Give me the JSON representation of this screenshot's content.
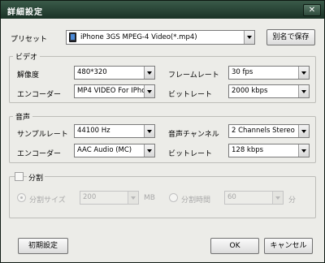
{
  "window": {
    "title": "詳細設定",
    "close_glyph": "✕"
  },
  "preset": {
    "label": "プリセット",
    "value": "iPhone 3GS MPEG-4 Video(*.mp4)",
    "save_as_label": "別名で保存"
  },
  "video": {
    "group_label": "ビデオ",
    "resolution_label": "解像度",
    "resolution_value": "480*320",
    "framerate_label": "フレームレート",
    "framerate_value": "30 fps",
    "encoder_label": "エンコーダー",
    "encoder_value": "MP4 VIDEO For IPhone",
    "bitrate_label": "ビットレート",
    "bitrate_value": "2000 kbps"
  },
  "audio": {
    "group_label": "音声",
    "samplerate_label": "サンプルレート",
    "samplerate_value": "44100 Hz",
    "channel_label": "音声チャンネル",
    "channel_value": "2 Channels Stereo",
    "encoder_label": "エンコーダー",
    "encoder_value": "AAC Audio (MC)",
    "bitrate_label": "ビットレート",
    "bitrate_value": "128 kbps"
  },
  "split": {
    "group_label": "分割",
    "by_size_label": "分割サイズ",
    "size_value": "200",
    "size_unit": "MB",
    "by_time_label": "分割時間",
    "time_value": "60",
    "time_unit": "分"
  },
  "footer": {
    "reset_label": "初期設定",
    "ok_label": "OK",
    "cancel_label": "キャンセル"
  }
}
